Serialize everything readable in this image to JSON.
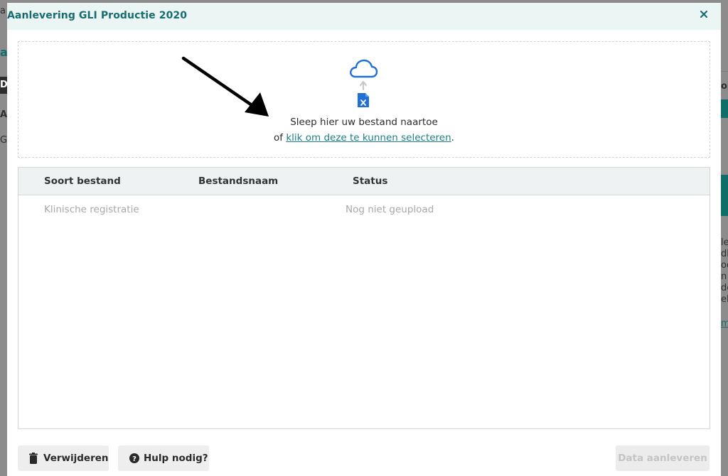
{
  "background": {
    "fragments": [
      "a",
      "at",
      "Da",
      "Aa",
      "GL",
      "op",
      "le",
      "dl",
      "oo",
      "n",
      "de",
      "elc",
      "m"
    ]
  },
  "modal": {
    "title": "Aanlevering GLI Productie 2020",
    "close_icon": "close-icon"
  },
  "dropzone": {
    "cloud_icon": "cloud-icon",
    "upload_arrow_icon": "upload-arrow-icon",
    "file_icon": "excel-file-icon",
    "line1": "Sleep hier uw bestand naartoe",
    "line2_prefix": "of ",
    "line2_link": "klik om deze te kunnen selecteren",
    "line2_suffix": "."
  },
  "table": {
    "headers": [
      "Soort bestand",
      "Bestandsnaam",
      "Status"
    ],
    "rows": [
      {
        "soort": "Klinische registratie",
        "naam": "",
        "status": "Nog niet geupload"
      }
    ]
  },
  "footer": {
    "delete_label": "Verwijderen",
    "delete_icon": "trash-icon",
    "help_label": "Hulp nodig?",
    "help_icon": "question-circle-icon",
    "submit_label": "Data aanleveren"
  },
  "colors": {
    "accent": "#176c70",
    "link": "#1a7f86",
    "icon_blue": "#1f6fd6"
  }
}
